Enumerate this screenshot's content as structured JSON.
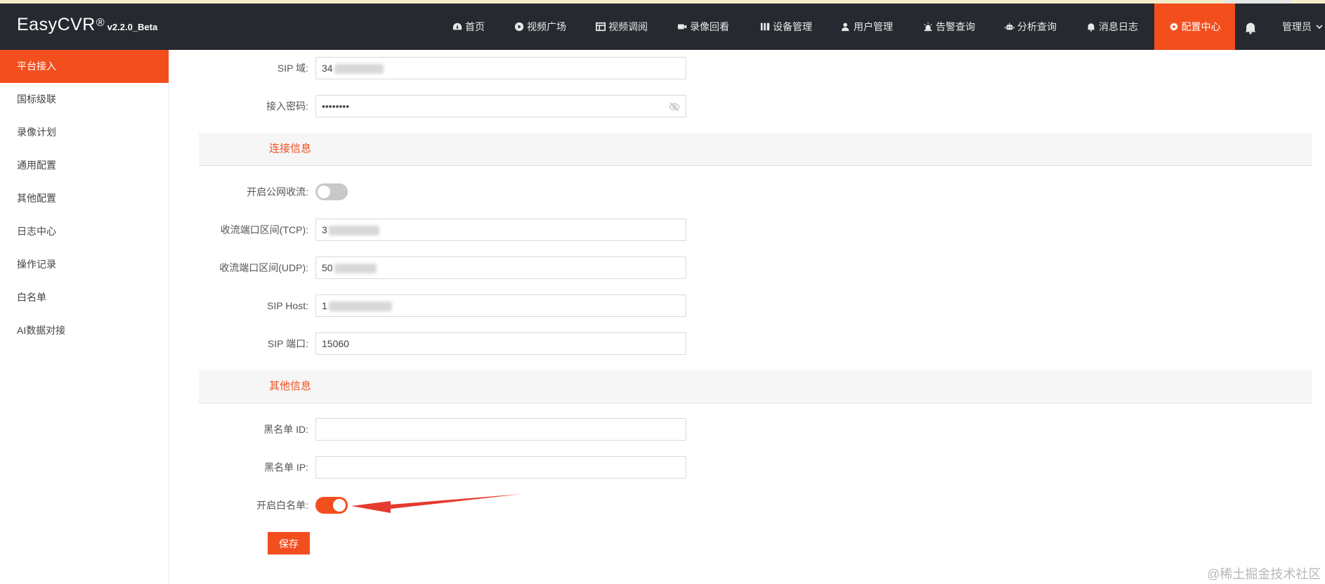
{
  "app": {
    "name": "EasyCVR",
    "registered": "®",
    "version": "v2.2.0_Beta"
  },
  "nav": [
    {
      "label": "首页",
      "icon": "dashboard-icon"
    },
    {
      "label": "视频广场",
      "icon": "play-circle-icon"
    },
    {
      "label": "视频调阅",
      "icon": "grid-layout-icon"
    },
    {
      "label": "录像回看",
      "icon": "video-camera-icon"
    },
    {
      "label": "设备管理",
      "icon": "device-columns-icon"
    },
    {
      "label": "用户管理",
      "icon": "user-icon"
    },
    {
      "label": "告警查询",
      "icon": "alarm-light-icon"
    },
    {
      "label": "分析查询",
      "icon": "robot-icon"
    },
    {
      "label": "消息日志",
      "icon": "bell-icon"
    },
    {
      "label": "配置中心",
      "icon": "gear-icon",
      "active": true
    }
  ],
  "user": {
    "label": "管理员"
  },
  "sidebar": {
    "items": [
      {
        "label": "平台接入",
        "active": true
      },
      {
        "label": "国标级联"
      },
      {
        "label": "录像计划"
      },
      {
        "label": "通用配置"
      },
      {
        "label": "其他配置"
      },
      {
        "label": "日志中心"
      },
      {
        "label": "操作记录"
      },
      {
        "label": "白名单"
      },
      {
        "label": "AI数据对接"
      }
    ]
  },
  "form": {
    "sip_domain": {
      "label": "SIP 域:",
      "value": "34"
    },
    "access_password": {
      "label": "接入密码:",
      "value": "••••••••"
    },
    "connection_section": "连接信息",
    "public_stream": {
      "label": "开启公网收流:",
      "on": false
    },
    "tcp_range": {
      "label": "收流端口区间(TCP):",
      "value": "3"
    },
    "udp_range": {
      "label": "收流端口区间(UDP):",
      "value": "50"
    },
    "sip_host": {
      "label": "SIP Host:",
      "value": "1"
    },
    "sip_port": {
      "label": "SIP 端口:",
      "value": "15060"
    },
    "other_section": "其他信息",
    "blacklist_id": {
      "label": "黑名单 ID:",
      "value": ""
    },
    "blacklist_ip": {
      "label": "黑名单 IP:",
      "value": ""
    },
    "whitelist": {
      "label": "开启白名单:",
      "on": true
    },
    "save_label": "保存"
  },
  "watermark": "@稀土掘金技术社区",
  "colors": {
    "accent": "#f24e1e",
    "header": "#262a30",
    "arrow": "#e53a2f"
  }
}
